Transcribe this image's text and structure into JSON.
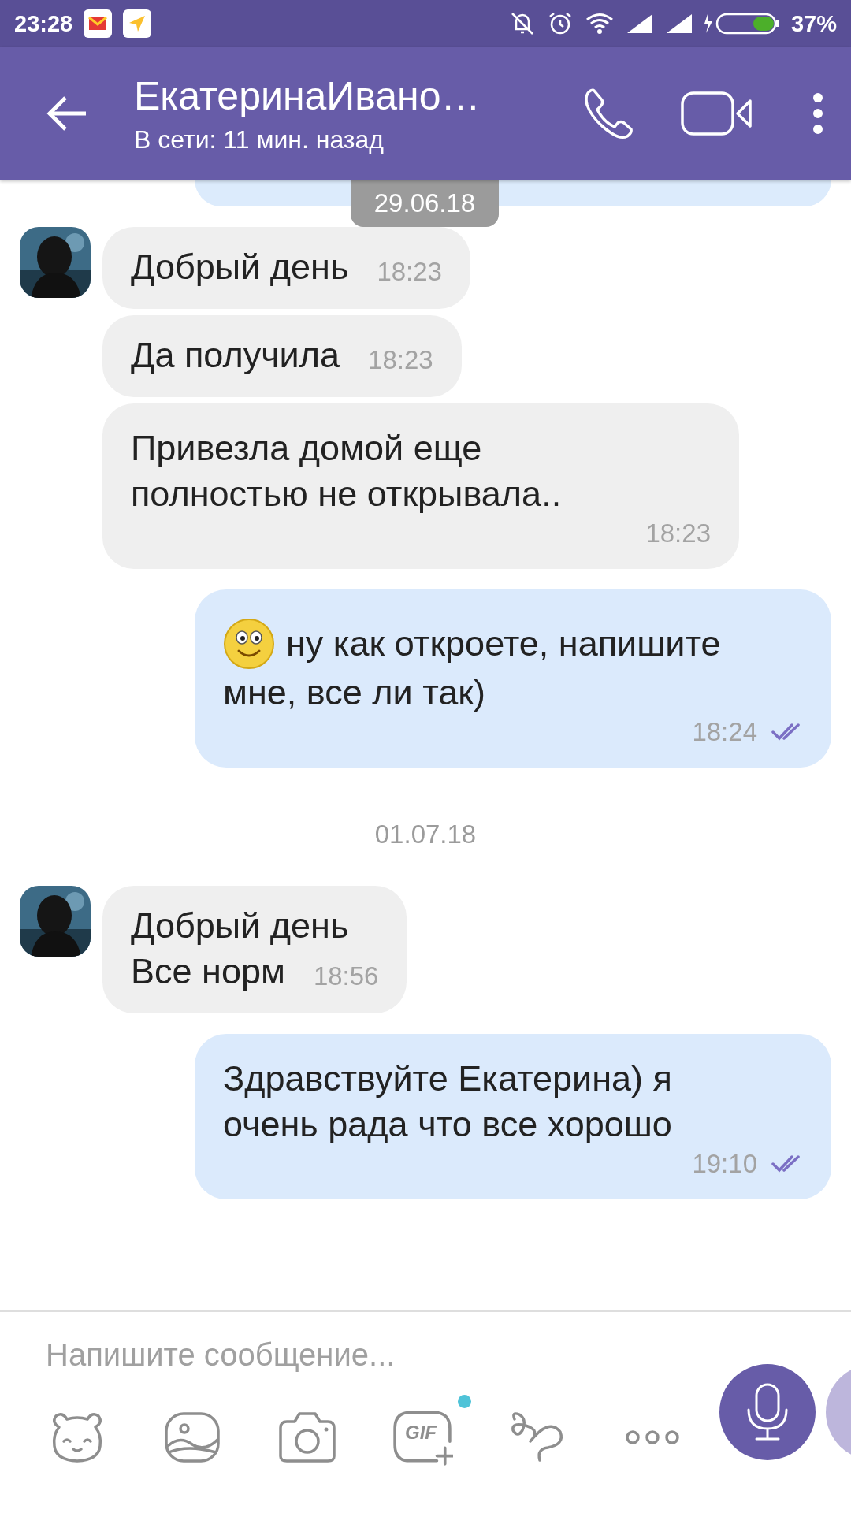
{
  "status_bar": {
    "time": "23:28",
    "battery": "37%"
  },
  "header": {
    "title": "ЕкатеринаИвано…",
    "subtitle": "В сети: 11 мин. назад"
  },
  "floating_date": "29.06.18",
  "messages": [
    {
      "kind": "incoming",
      "avatar": true,
      "lines": [
        "Добрый день"
      ],
      "time": "18:23"
    },
    {
      "kind": "incoming",
      "avatar": false,
      "lines": [
        "Да получила"
      ],
      "time": "18:23"
    },
    {
      "kind": "incoming",
      "avatar": false,
      "lines": [
        "Привезла домой еще",
        "полностью не открывала.."
      ],
      "time": "18:23"
    },
    {
      "kind": "outgoing",
      "smiley": true,
      "lines": [
        "ну как откроете, напишите",
        "мне, все ли так)"
      ],
      "time": "18:24",
      "read": true
    },
    {
      "kind": "date",
      "text": "01.07.18"
    },
    {
      "kind": "incoming",
      "avatar": true,
      "lines": [
        "Добрый день",
        "Все норм"
      ],
      "time": "18:56"
    },
    {
      "kind": "outgoing",
      "smiley": false,
      "lines": [
        "Здравствуйте Екатерина) я",
        "очень рада что все хорошо"
      ],
      "time": "19:10",
      "read": true
    }
  ],
  "composer": {
    "placeholder": "Напишите сообщение...",
    "gif_label": "GIF",
    "gif_badge": true
  }
}
